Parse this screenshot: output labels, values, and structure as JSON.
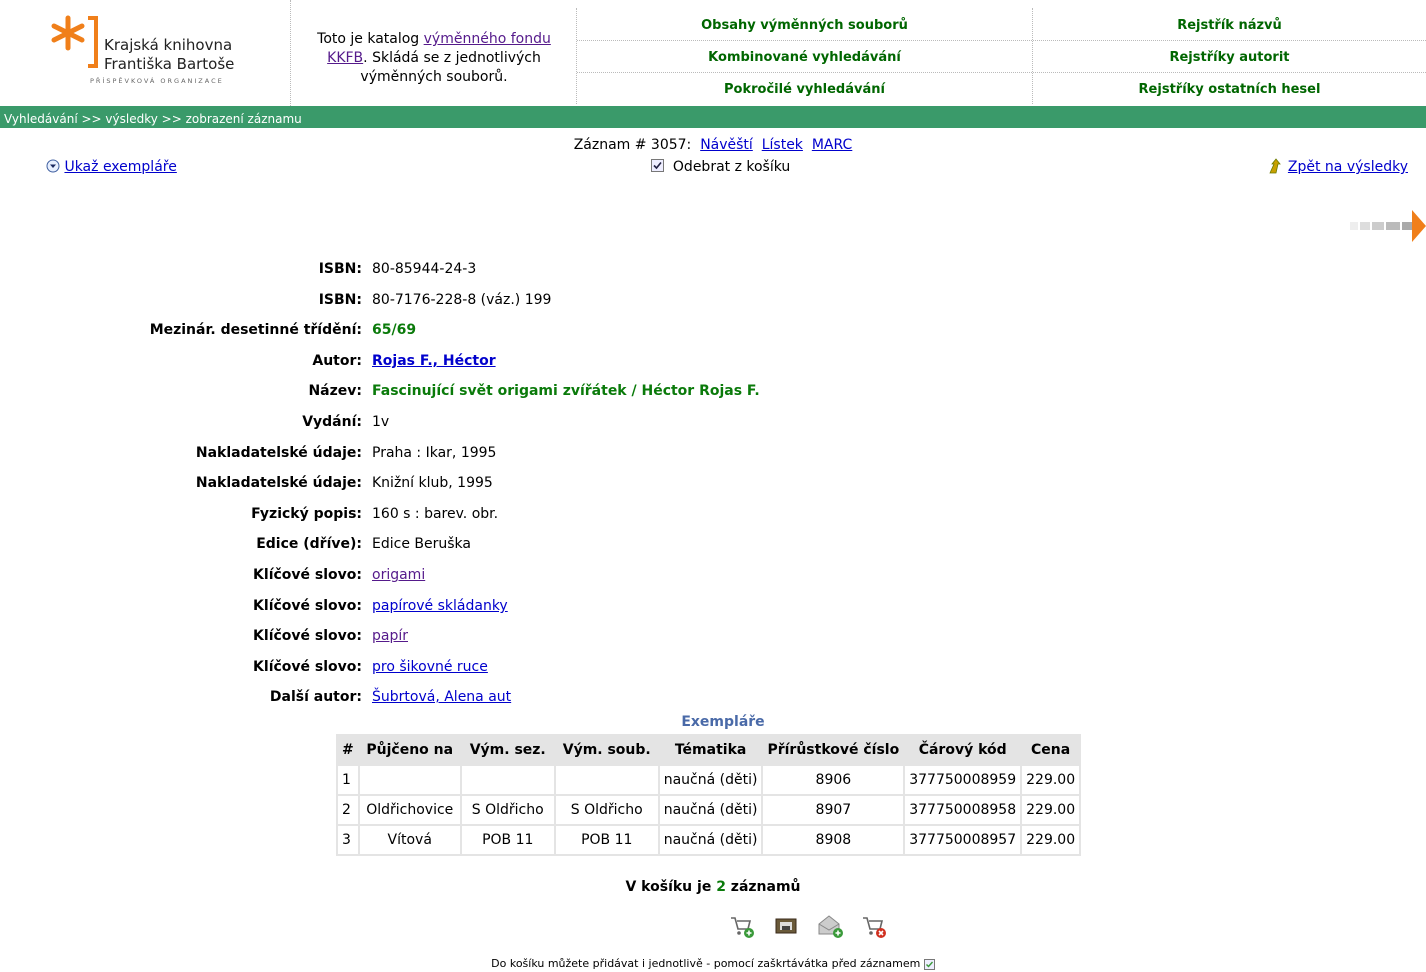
{
  "header": {
    "logo_line1": "Krajská knihovna",
    "logo_line2": "Františka Bartoše",
    "logo_sub": "PŘÍSPĚVKOVÁ ORGANIZACE",
    "intro_pre": "Toto je katalog ",
    "intro_link1": "výměnného fondu",
    "intro_link2": "KKFB",
    "intro_post": ". Skládá se z jednotlivých výměnných souborů.",
    "nav": {
      "contents": "Obsahy výměnných souborů",
      "combined": "Kombinované vyhledávání",
      "advanced": "Pokročilé vyhledávání",
      "title_index": "Rejstřík názvů",
      "authority_index": "Rejstříky autorit",
      "other_index": "Rejstříky ostatních hesel"
    }
  },
  "breadcrumb": "Vyhledávání >> výsledky >> zobrazení záznamu",
  "record": {
    "number_label": "Záznam # 3057:",
    "formats": [
      "Návěští",
      "Lístek",
      "MARC"
    ],
    "remove_from_cart": "Odebrat z košíku",
    "show_items": "Ukaž exempláře",
    "back_to_results": "Zpět na výsledky"
  },
  "fields": [
    {
      "label": "ISBN:",
      "value": "80-85944-24-3",
      "style": "plain"
    },
    {
      "label": "ISBN:",
      "value": "80-7176-228-8 (váz.) 199",
      "style": "plain"
    },
    {
      "label": "Mezinár. desetinné třídění:",
      "value": "65/69",
      "style": "green"
    },
    {
      "label": "Autor:",
      "value": "Rojas F., Héctor",
      "style": "bluebold"
    },
    {
      "label": "Název:",
      "value": "Fascinující svět origami zvířátek / Héctor Rojas F.",
      "style": "green"
    },
    {
      "label": "Vydání:",
      "value": "1v",
      "style": "plain"
    },
    {
      "label": "Nakladatelské údaje:",
      "value": "Praha : Ikar, 1995",
      "style": "plain"
    },
    {
      "label": "Nakladatelské údaje:",
      "value": "Knižní klub, 1995",
      "style": "plain"
    },
    {
      "label": "Fyzický popis:",
      "value": "160 s : barev. obr.",
      "style": "plain"
    },
    {
      "label": "Edice (dříve):",
      "value": "Edice Beruška",
      "style": "plain"
    },
    {
      "label": "Klíčové slovo:",
      "value": "origami",
      "style": "purplelink"
    },
    {
      "label": "Klíčové slovo:",
      "value": "papírové skládanky",
      "style": "link"
    },
    {
      "label": "Klíčové slovo:",
      "value": "papír",
      "style": "purplelink"
    },
    {
      "label": "Klíčové slovo:",
      "value": "pro šikovné ruce",
      "style": "link"
    },
    {
      "label": "Další autor:",
      "value": "Šubrtová, Alena aut",
      "style": "link"
    }
  ],
  "items": {
    "caption": "Exempláře",
    "headers": [
      "#",
      "Půjčeno na",
      "Vým. sez.",
      "Vým. soub.",
      "Tématika",
      "Přírůstkové číslo",
      "Čárový kód",
      "Cena"
    ],
    "rows": [
      [
        "1",
        "",
        "",
        "",
        "naučná (děti)",
        "8906",
        "377750008959",
        "229.00"
      ],
      [
        "2",
        "Oldřichovice",
        "S Oldřicho",
        "S Oldřicho",
        "naučná (děti)",
        "8907",
        "377750008958",
        "229.00"
      ],
      [
        "3",
        "Vítová",
        "POB 11",
        "POB 11",
        "naučná (děti)",
        "8908",
        "377750008957",
        "229.00"
      ]
    ]
  },
  "basket": {
    "pre": "V košíku je ",
    "count": "2",
    "post": " záznamů",
    "note": "Do košíku můžete přidávat i jednotlivě - pomocí zaškrtávátka před záznamem"
  },
  "colors": {
    "green_bar": "#3a9a6a",
    "nav_green": "#006600",
    "logo_orange": "#f07f1a"
  }
}
